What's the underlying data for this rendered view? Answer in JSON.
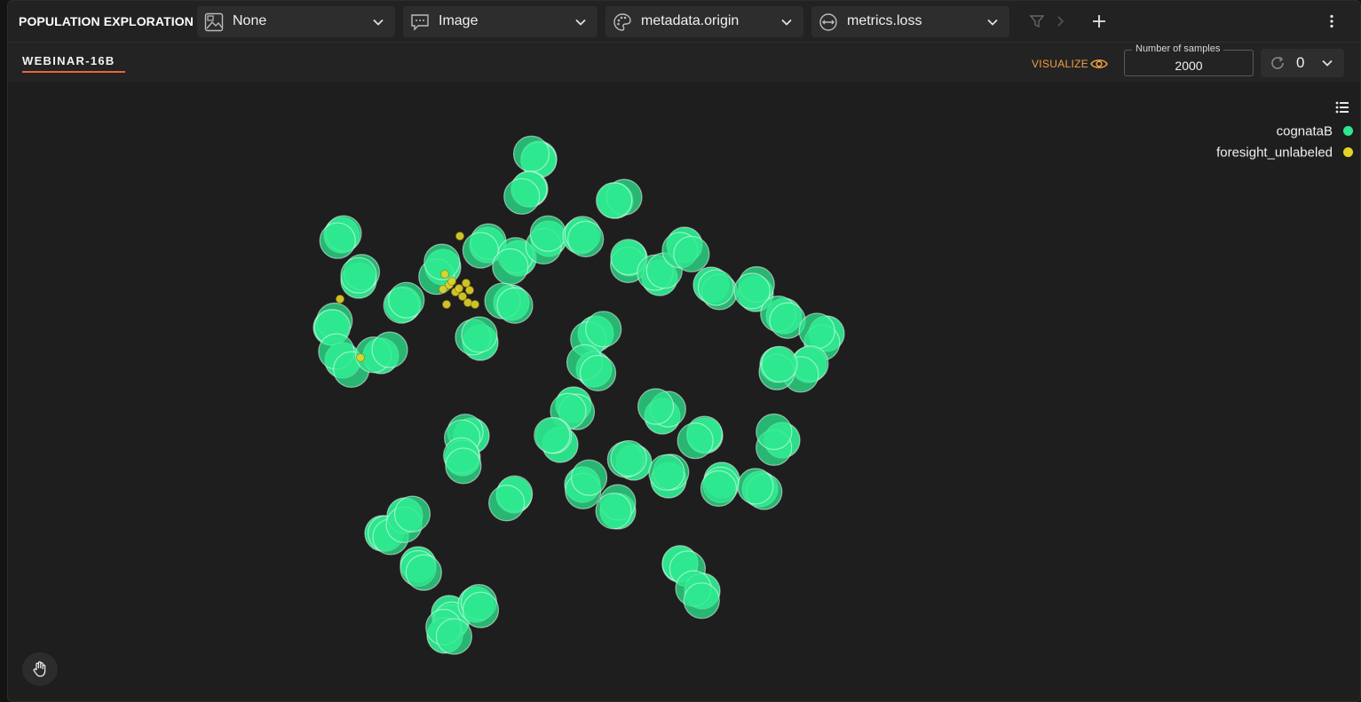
{
  "toolbar": {
    "title": "POPULATION EXPLORATION",
    "dropdowns": [
      {
        "id": "image",
        "icon": "image-icon",
        "value": "None"
      },
      {
        "id": "tooltip",
        "icon": "chat-icon",
        "value": "Image"
      },
      {
        "id": "color",
        "icon": "palette-icon",
        "value": "metadata.origin"
      },
      {
        "id": "size",
        "icon": "resize-icon",
        "value": "metrics.loss"
      }
    ]
  },
  "subbar": {
    "session": "WEBINAR-16B",
    "visualize_label": "VISUALIZE",
    "samples_label": "Number of samples",
    "samples_value": "2000",
    "refresh_count": "0"
  },
  "legend": [
    {
      "label": "cognataB",
      "color": "#2ee88f"
    },
    {
      "label": "foresight_unlabeled",
      "color": "#e2d42a"
    }
  ],
  "chart_data": {
    "type": "scatter",
    "title": "",
    "xlabel": "",
    "ylabel": "",
    "grid": false,
    "legend_position": "top-right",
    "series": [
      {
        "name": "cognataB",
        "color": "#2ee88f",
        "points": [
          [
            606,
            178
          ],
          [
            596,
            212
          ],
          [
            384,
            264
          ],
          [
            403,
            315
          ],
          [
            372,
            368
          ],
          [
            385,
            405
          ],
          [
            428,
            400
          ],
          [
            453,
            342
          ],
          [
            498,
            300
          ],
          [
            548,
            275
          ],
          [
            583,
            290
          ],
          [
            617,
            268
          ],
          [
            653,
            265
          ],
          [
            540,
            385
          ],
          [
            575,
            340
          ],
          [
            692,
            225
          ],
          [
            708,
            290
          ],
          [
            742,
            312
          ],
          [
            770,
            275
          ],
          [
            800,
            320
          ],
          [
            850,
            330
          ],
          [
            882,
            355
          ],
          [
            930,
            375
          ],
          [
            910,
            410
          ],
          [
            875,
            410
          ],
          [
            670,
            375
          ],
          [
            668,
            415
          ],
          [
            645,
            455
          ],
          [
            630,
            500
          ],
          [
            655,
            545
          ],
          [
            695,
            575
          ],
          [
            713,
            520
          ],
          [
            745,
            468
          ],
          [
            752,
            540
          ],
          [
            793,
            490
          ],
          [
            812,
            540
          ],
          [
            855,
            550
          ],
          [
            880,
            495
          ],
          [
            530,
            490
          ],
          [
            520,
            515
          ],
          [
            578,
            557
          ],
          [
            430,
            600
          ],
          [
            455,
            580
          ],
          [
            470,
            635
          ],
          [
            505,
            690
          ],
          [
            500,
            715
          ],
          [
            535,
            680
          ],
          [
            765,
            635
          ],
          [
            790,
            665
          ]
        ]
      },
      {
        "name": "foresight_unlabeled",
        "color": "#e2d42a",
        "points": [
          [
            517,
            265
          ],
          [
            500,
            308
          ],
          [
            505,
            320
          ],
          [
            512,
            328
          ],
          [
            520,
            333
          ],
          [
            526,
            340
          ],
          [
            516,
            324
          ],
          [
            508,
            316
          ],
          [
            528,
            326
          ],
          [
            498,
            325
          ],
          [
            534,
            342
          ],
          [
            502,
            342
          ],
          [
            382,
            336
          ],
          [
            405,
            402
          ],
          [
            524,
            318
          ]
        ]
      }
    ]
  }
}
